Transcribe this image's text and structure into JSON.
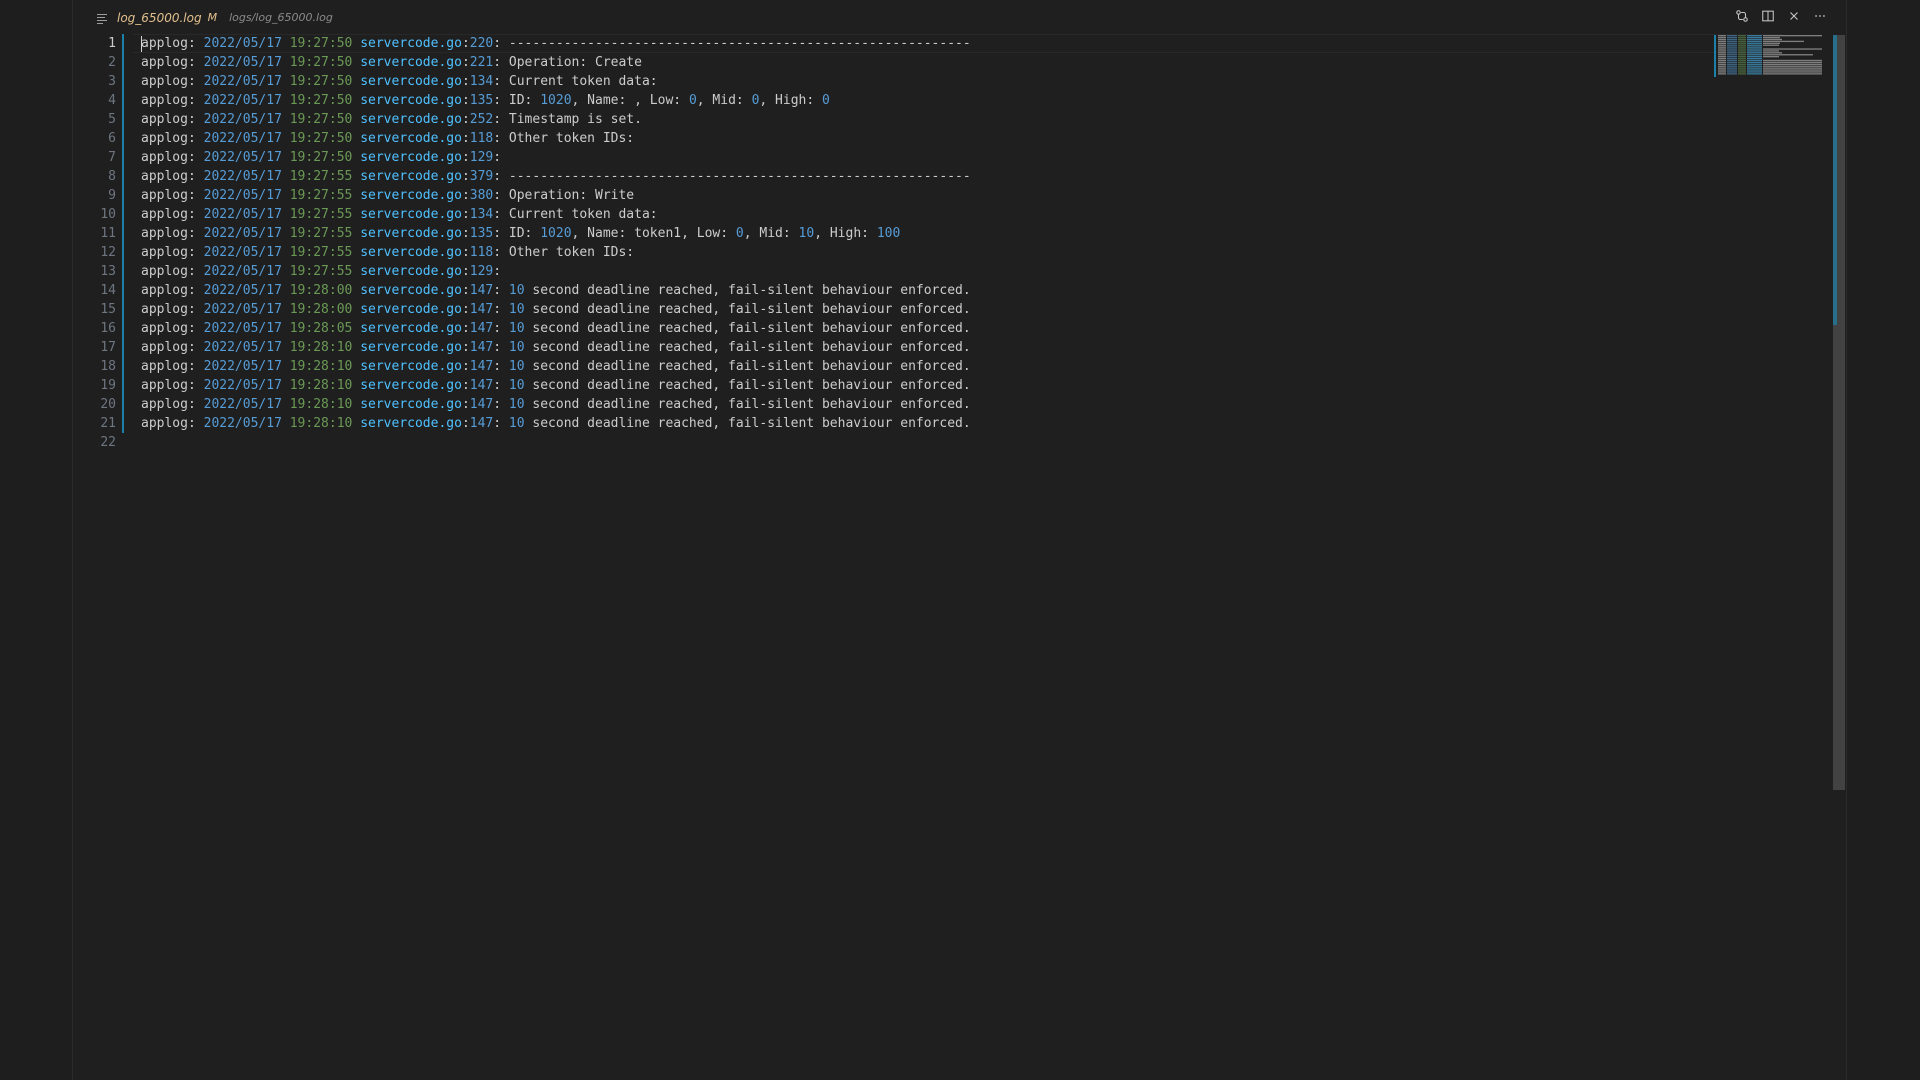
{
  "tab": {
    "file_name": "log_65000.log",
    "modified_marker": "M",
    "path": "logs/log_65000.log"
  },
  "actions": [
    {
      "name": "open-changes-button",
      "icon": "git-compare-icon"
    },
    {
      "name": "split-editor-button",
      "icon": "split-editor-icon"
    },
    {
      "name": "close-tab-button",
      "icon": "close-icon"
    },
    {
      "name": "more-actions-button",
      "icon": "ellipsis-icon"
    }
  ],
  "colors": {
    "date": "#569cd6",
    "time": "#6a9955",
    "file": "#4fc1ff",
    "number": "#569cd6",
    "text": "#cccccc",
    "git_added": "#1b81a8"
  },
  "editor": {
    "active_line": "1",
    "lines": [
      {
        "n": "1",
        "prefix": "applog: ",
        "date": "2022/05/17",
        "time": "19:27:50",
        "file": "servercode.go",
        "lineno": "220",
        "msg": [
          {
            "t": "-----------------------------------------------------------"
          }
        ]
      },
      {
        "n": "2",
        "prefix": "applog: ",
        "date": "2022/05/17",
        "time": "19:27:50",
        "file": "servercode.go",
        "lineno": "221",
        "msg": [
          {
            "t": "Operation: Create"
          }
        ]
      },
      {
        "n": "3",
        "prefix": "applog: ",
        "date": "2022/05/17",
        "time": "19:27:50",
        "file": "servercode.go",
        "lineno": "134",
        "msg": [
          {
            "t": "Current token data:"
          }
        ]
      },
      {
        "n": "4",
        "prefix": "applog: ",
        "date": "2022/05/17",
        "time": "19:27:50",
        "file": "servercode.go",
        "lineno": "135",
        "msg": [
          {
            "t": "ID: "
          },
          {
            "t": "1020",
            "num": true
          },
          {
            "t": ", Name: , Low: "
          },
          {
            "t": "0",
            "num": true
          },
          {
            "t": ", Mid: "
          },
          {
            "t": "0",
            "num": true
          },
          {
            "t": ", High: "
          },
          {
            "t": "0",
            "num": true
          }
        ]
      },
      {
        "n": "5",
        "prefix": "applog: ",
        "date": "2022/05/17",
        "time": "19:27:50",
        "file": "servercode.go",
        "lineno": "252",
        "msg": [
          {
            "t": "Timestamp is set."
          }
        ]
      },
      {
        "n": "6",
        "prefix": "applog: ",
        "date": "2022/05/17",
        "time": "19:27:50",
        "file": "servercode.go",
        "lineno": "118",
        "msg": [
          {
            "t": "Other token IDs:"
          }
        ]
      },
      {
        "n": "7",
        "prefix": "applog: ",
        "date": "2022/05/17",
        "time": "19:27:50",
        "file": "servercode.go",
        "lineno": "129",
        "msg": []
      },
      {
        "n": "8",
        "prefix": "applog: ",
        "date": "2022/05/17",
        "time": "19:27:55",
        "file": "servercode.go",
        "lineno": "379",
        "msg": [
          {
            "t": "-----------------------------------------------------------"
          }
        ]
      },
      {
        "n": "9",
        "prefix": "applog: ",
        "date": "2022/05/17",
        "time": "19:27:55",
        "file": "servercode.go",
        "lineno": "380",
        "msg": [
          {
            "t": "Operation: Write"
          }
        ]
      },
      {
        "n": "10",
        "prefix": "applog: ",
        "date": "2022/05/17",
        "time": "19:27:55",
        "file": "servercode.go",
        "lineno": "134",
        "msg": [
          {
            "t": "Current token data:"
          }
        ]
      },
      {
        "n": "11",
        "prefix": "applog: ",
        "date": "2022/05/17",
        "time": "19:27:55",
        "file": "servercode.go",
        "lineno": "135",
        "msg": [
          {
            "t": "ID: "
          },
          {
            "t": "1020",
            "num": true
          },
          {
            "t": ", Name: token1, Low: "
          },
          {
            "t": "0",
            "num": true
          },
          {
            "t": ", Mid: "
          },
          {
            "t": "10",
            "num": true
          },
          {
            "t": ", High: "
          },
          {
            "t": "100",
            "num": true
          }
        ]
      },
      {
        "n": "12",
        "prefix": "applog: ",
        "date": "2022/05/17",
        "time": "19:27:55",
        "file": "servercode.go",
        "lineno": "118",
        "msg": [
          {
            "t": "Other token IDs:"
          }
        ]
      },
      {
        "n": "13",
        "prefix": "applog: ",
        "date": "2022/05/17",
        "time": "19:27:55",
        "file": "servercode.go",
        "lineno": "129",
        "msg": []
      },
      {
        "n": "14",
        "prefix": "applog: ",
        "date": "2022/05/17",
        "time": "19:28:00",
        "file": "servercode.go",
        "lineno": "147",
        "msg": [
          {
            "t": "10",
            "num": true
          },
          {
            "t": " second deadline reached, fail-silent behaviour enforced."
          }
        ]
      },
      {
        "n": "15",
        "prefix": "applog: ",
        "date": "2022/05/17",
        "time": "19:28:00",
        "file": "servercode.go",
        "lineno": "147",
        "msg": [
          {
            "t": "10",
            "num": true
          },
          {
            "t": " second deadline reached, fail-silent behaviour enforced."
          }
        ]
      },
      {
        "n": "16",
        "prefix": "applog: ",
        "date": "2022/05/17",
        "time": "19:28:05",
        "file": "servercode.go",
        "lineno": "147",
        "msg": [
          {
            "t": "10",
            "num": true
          },
          {
            "t": " second deadline reached, fail-silent behaviour enforced."
          }
        ]
      },
      {
        "n": "17",
        "prefix": "applog: ",
        "date": "2022/05/17",
        "time": "19:28:10",
        "file": "servercode.go",
        "lineno": "147",
        "msg": [
          {
            "t": "10",
            "num": true
          },
          {
            "t": " second deadline reached, fail-silent behaviour enforced."
          }
        ]
      },
      {
        "n": "18",
        "prefix": "applog: ",
        "date": "2022/05/17",
        "time": "19:28:10",
        "file": "servercode.go",
        "lineno": "147",
        "msg": [
          {
            "t": "10",
            "num": true
          },
          {
            "t": " second deadline reached, fail-silent behaviour enforced."
          }
        ]
      },
      {
        "n": "19",
        "prefix": "applog: ",
        "date": "2022/05/17",
        "time": "19:28:10",
        "file": "servercode.go",
        "lineno": "147",
        "msg": [
          {
            "t": "10",
            "num": true
          },
          {
            "t": " second deadline reached, fail-silent behaviour enforced."
          }
        ]
      },
      {
        "n": "20",
        "prefix": "applog: ",
        "date": "2022/05/17",
        "time": "19:28:10",
        "file": "servercode.go",
        "lineno": "147",
        "msg": [
          {
            "t": "10",
            "num": true
          },
          {
            "t": " second deadline reached, fail-silent behaviour enforced."
          }
        ]
      },
      {
        "n": "21",
        "prefix": "applog: ",
        "date": "2022/05/17",
        "time": "19:28:10",
        "file": "servercode.go",
        "lineno": "147",
        "msg": [
          {
            "t": "10",
            "num": true
          },
          {
            "t": " second deadline reached, fail-silent behaviour enforced."
          }
        ]
      },
      {
        "n": "22",
        "empty": true
      }
    ]
  }
}
